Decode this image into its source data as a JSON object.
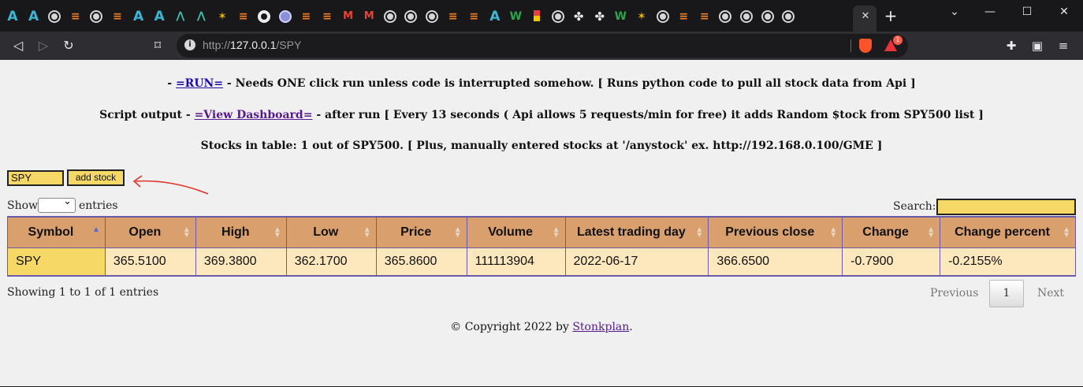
{
  "browser": {
    "tabs": [
      {
        "icon": "arweave-icon",
        "glyph": "A",
        "cls": "ic-a"
      },
      {
        "icon": "arweave-icon",
        "glyph": "A",
        "cls": "ic-a"
      },
      {
        "icon": "globe-icon",
        "glyph": "",
        "cls": "ic-globe"
      },
      {
        "icon": "stackoverflow-icon",
        "glyph": "≡",
        "cls": "ic-so"
      },
      {
        "icon": "globe-icon",
        "glyph": "",
        "cls": "ic-globe"
      },
      {
        "icon": "stackoverflow-icon",
        "glyph": "≡",
        "cls": "ic-so"
      },
      {
        "icon": "arweave-icon",
        "glyph": "A",
        "cls": "ic-a"
      },
      {
        "icon": "arweave-icon",
        "glyph": "A",
        "cls": "ic-a"
      },
      {
        "icon": "triangle-icon",
        "glyph": "⋀",
        "cls": "ic-tri"
      },
      {
        "icon": "triangle-icon",
        "glyph": "⋀",
        "cls": "ic-tri"
      },
      {
        "icon": "star-burst-icon",
        "glyph": "✶",
        "cls": "ic-star"
      },
      {
        "icon": "stackoverflow-icon",
        "glyph": "≡",
        "cls": "ic-so"
      },
      {
        "icon": "github-icon",
        "glyph": "",
        "cls": "ic-gh"
      },
      {
        "icon": "orb-icon",
        "glyph": "",
        "cls": "ic-orb"
      },
      {
        "icon": "stackoverflow-icon",
        "glyph": "≡",
        "cls": "ic-so"
      },
      {
        "icon": "stackoverflow-icon",
        "glyph": "≡",
        "cls": "ic-so"
      },
      {
        "icon": "gmail-icon",
        "glyph": "M",
        "cls": "ic-m"
      },
      {
        "icon": "gmail-icon",
        "glyph": "M",
        "cls": "ic-m"
      },
      {
        "icon": "globe-icon",
        "glyph": "",
        "cls": "ic-globe"
      },
      {
        "icon": "globe-icon",
        "glyph": "",
        "cls": "ic-globe"
      },
      {
        "icon": "globe-icon",
        "glyph": "",
        "cls": "ic-globe"
      },
      {
        "icon": "stackoverflow-icon",
        "glyph": "≡",
        "cls": "ic-so"
      },
      {
        "icon": "stackoverflow-icon",
        "glyph": "≡",
        "cls": "ic-so"
      },
      {
        "icon": "arweave-icon",
        "glyph": "A",
        "cls": "ic-a"
      },
      {
        "icon": "w-icon",
        "glyph": "W",
        "cls": "ic-w"
      },
      {
        "icon": "flag-icon",
        "glyph": "",
        "cls": "ic-ybar"
      },
      {
        "icon": "globe-icon",
        "glyph": "",
        "cls": "ic-globe"
      },
      {
        "icon": "clover-icon",
        "glyph": "✤",
        "cls": "ic-clover"
      },
      {
        "icon": "clover-icon",
        "glyph": "✤",
        "cls": "ic-clover"
      },
      {
        "icon": "w-icon",
        "glyph": "W",
        "cls": "ic-w"
      },
      {
        "icon": "star-burst-icon",
        "glyph": "✶",
        "cls": "ic-star"
      },
      {
        "icon": "globe-icon",
        "glyph": "",
        "cls": "ic-globe"
      },
      {
        "icon": "stackoverflow-icon",
        "glyph": "≡",
        "cls": "ic-so"
      },
      {
        "icon": "stackoverflow-icon",
        "glyph": "≡",
        "cls": "ic-so"
      },
      {
        "icon": "globe-icon",
        "glyph": "",
        "cls": "ic-globe"
      },
      {
        "icon": "globe-icon",
        "glyph": "",
        "cls": "ic-globe"
      },
      {
        "icon": "globe-icon",
        "glyph": "",
        "cls": "ic-globe"
      },
      {
        "icon": "globe-icon",
        "glyph": "",
        "cls": "ic-globe"
      }
    ],
    "url_prefix": "http://",
    "url_host": "127.0.0.1",
    "url_path": "/SPY",
    "rewards_badge": "1"
  },
  "page": {
    "line1": {
      "prefix": "- ",
      "link": "=RUN=",
      "suffix": " - Needs ONE click run unless code is interrupted somehow. [ Runs python code to pull all stock data from Api ]"
    },
    "line2": {
      "prefix": "Script output - ",
      "link": "=View Dashboard=",
      "suffix": " - after run [ Every 13 seconds ( Api allows 5 requests/min for free) it adds Random $tock from SPY500 list ]"
    },
    "line3": "Stocks in table: 1 out of SPY500. [ Plus, manually entered stocks at '/anystock' ex. http://192.168.0.100/GME ]",
    "stock_input_value": "SPY",
    "add_button": "add stock",
    "show_label": "Show",
    "entries_label": "entries",
    "search_label": "Search:",
    "table": {
      "headers": [
        "Symbol",
        "Open",
        "High",
        "Low",
        "Price",
        "Volume",
        "Latest trading day",
        "Previous close",
        "Change",
        "Change percent"
      ],
      "rows": [
        [
          "SPY",
          "365.5100",
          "369.3800",
          "362.1700",
          "365.8600",
          "111113904",
          "2022-06-17",
          "366.6500",
          "-0.7900",
          "-0.2155%"
        ]
      ]
    },
    "info": "Showing 1 to 1 of 1 entries",
    "pagination": {
      "previous": "Previous",
      "current": "1",
      "next": "Next"
    },
    "footer": {
      "prefix": "© Copyright 2022 by ",
      "link": "Stonkplan",
      "suffix": "."
    }
  },
  "colors": {
    "header_bg": "#d99f6d",
    "row_bg": "#fde7bd",
    "input_bg": "#f6d867",
    "border": "#6a5aa8",
    "arrow": "#e0332a"
  }
}
